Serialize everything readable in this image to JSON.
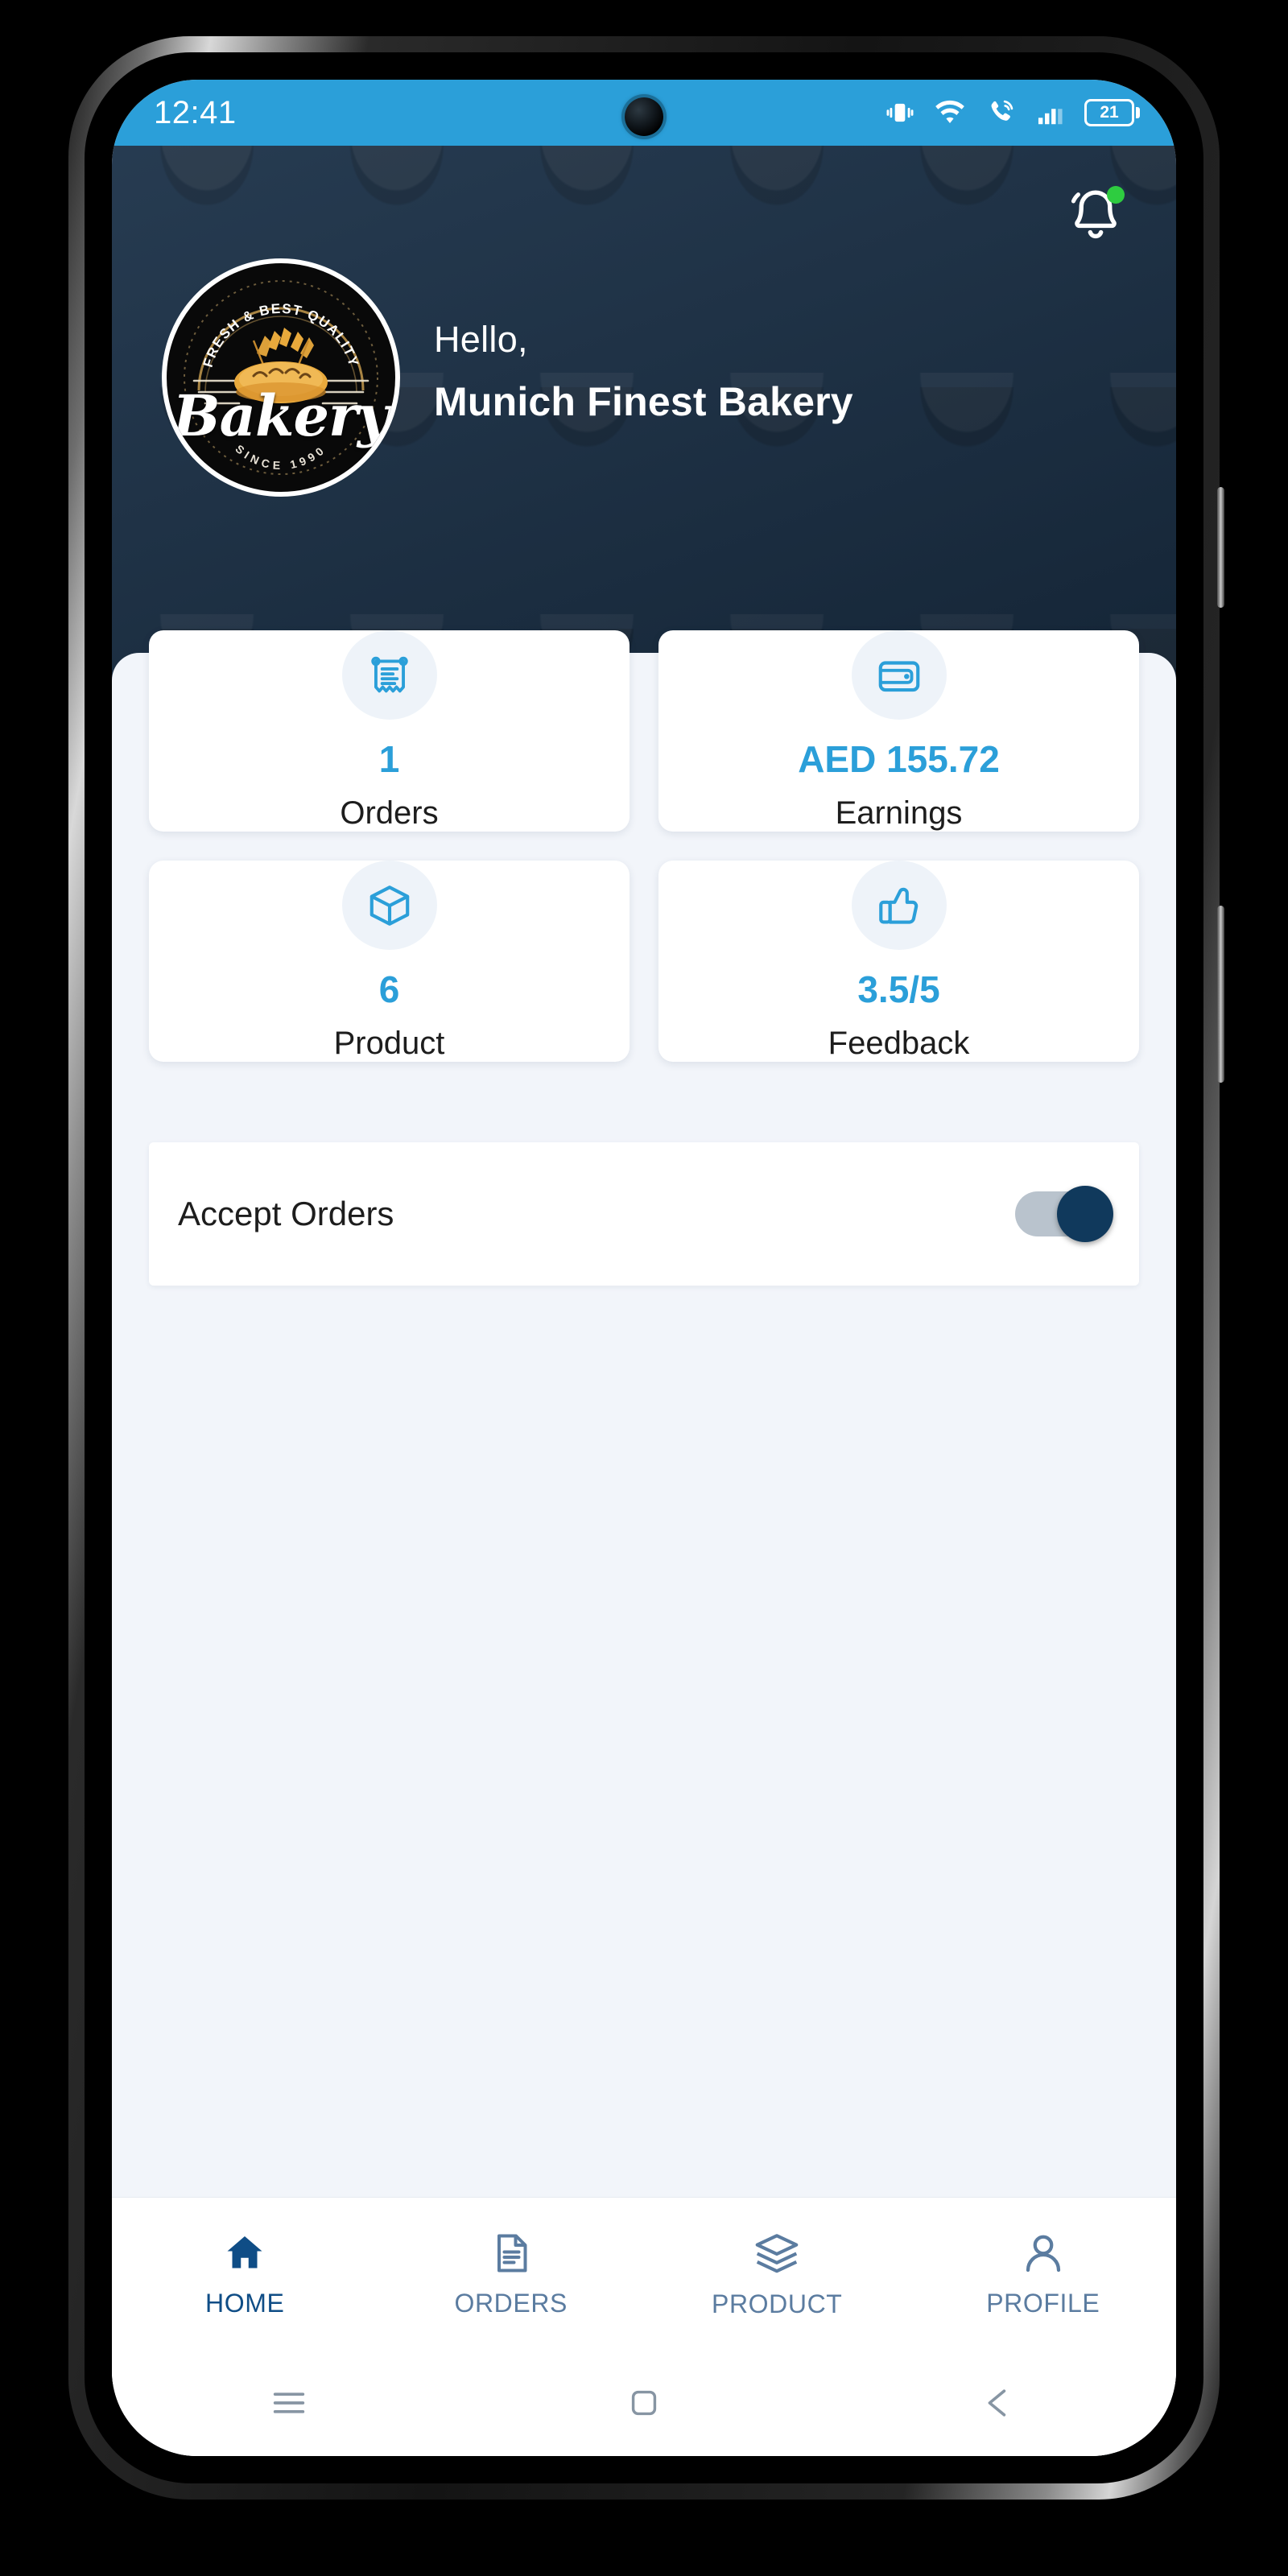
{
  "status_bar": {
    "clock": "12:41",
    "battery_level": "21",
    "icons": [
      "vibrate-icon",
      "wifi-icon",
      "call-icon",
      "signal-icon",
      "battery-icon"
    ]
  },
  "header": {
    "greeting_line": "Hello,",
    "business_name": "Munich Finest Bakery",
    "notification_icon": "bell-icon",
    "has_unread": true,
    "background_color": "#1b3148",
    "logo": {
      "arc_top_text": "FRESH & BEST QUALITY",
      "wordmark": "Bakery",
      "arc_bottom_text": "SINCE 1990"
    }
  },
  "stats": [
    {
      "icon": "receipt-icon",
      "value": "1",
      "label": "Orders"
    },
    {
      "icon": "wallet-icon",
      "value": "AED 155.72",
      "label": "Earnings"
    },
    {
      "icon": "box-icon",
      "value": "6",
      "label": "Product"
    },
    {
      "icon": "thumbs-up-icon",
      "value": "3.5/5",
      "label": "Feedback"
    }
  ],
  "accept_orders": {
    "label": "Accept Orders",
    "enabled": true
  },
  "bottom_nav": {
    "active": "HOME",
    "items": [
      {
        "icon": "home-icon",
        "label": "HOME"
      },
      {
        "icon": "orders-icon",
        "label": "ORDERS"
      },
      {
        "icon": "layers-icon",
        "label": "PRODUCT"
      },
      {
        "icon": "person-icon",
        "label": "PROFILE"
      }
    ]
  },
  "system_nav": {
    "items": [
      "menu-icon",
      "home-square-icon",
      "back-triangle-icon"
    ]
  },
  "colors": {
    "status_bar": "#2b9fd9",
    "accent": "#2b9fd9",
    "header_navy": "#1b3148",
    "page_bg": "#f2f5fa",
    "nav_inactive": "#5b7ca0",
    "nav_active": "#0f4d86",
    "toggle_on": "#10395c",
    "badge_green": "#2ecc40"
  }
}
